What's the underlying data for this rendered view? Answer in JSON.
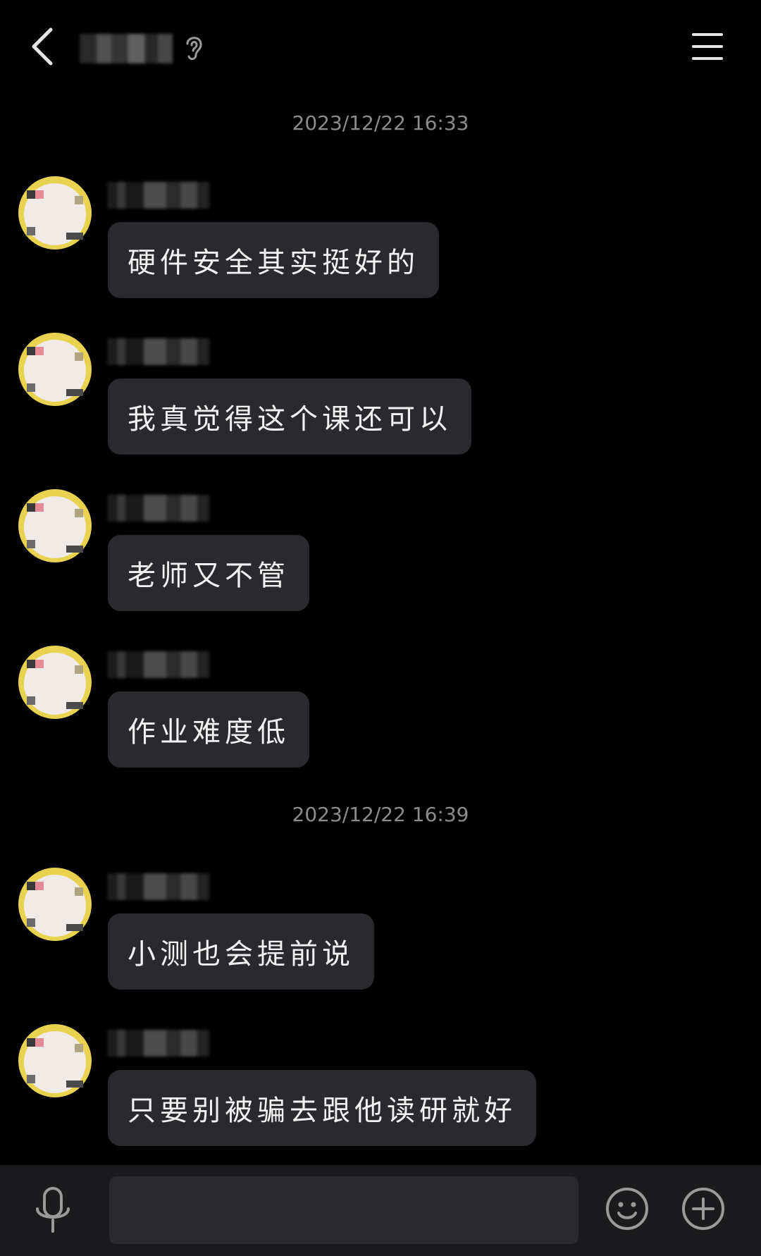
{
  "header": {
    "back_icon": "chevron-left-icon",
    "title_blurred": true,
    "ear_icon": "ear-icon",
    "menu_icon": "menu-icon"
  },
  "conversation": {
    "timestamps": [
      "2023/12/22 16:33",
      "2023/12/22 16:39"
    ],
    "messages": [
      {
        "text": "硬件安全其实挺好的"
      },
      {
        "text": "我真觉得这个课还可以"
      },
      {
        "text": "老师又不管"
      },
      {
        "text": "作业难度低"
      },
      {
        "text": "小测也会提前说"
      },
      {
        "text": "只要别被骗去跟他读研就好"
      }
    ]
  },
  "composer": {
    "mic_icon": "microphone-icon",
    "input_value": "",
    "emoji_icon": "smiley-icon",
    "plus_icon": "plus-circle-icon"
  },
  "colors": {
    "background": "#000000",
    "bubble": "#2a292e",
    "timestamp": "#8c8c8c",
    "bottom_bar": "#1b1b1d"
  }
}
